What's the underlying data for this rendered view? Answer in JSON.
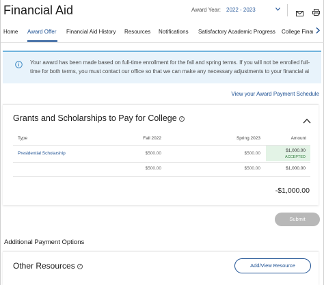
{
  "app": {
    "title": "Financial Aid"
  },
  "header": {
    "award_year_label": "Award Year:",
    "award_year_value": "2022 - 2023",
    "icons": [
      "chevron-down-icon",
      "mail-icon",
      "print-icon"
    ]
  },
  "tabs": [
    {
      "label": "Home",
      "active": false
    },
    {
      "label": "Award Offer",
      "active": true
    },
    {
      "label": "Financial Aid History",
      "active": false
    },
    {
      "label": "Resources",
      "active": false
    },
    {
      "label": "Notifications",
      "active": false
    },
    {
      "label": "Satisfactory Academic Progress",
      "active": false
    },
    {
      "label": "College Financ",
      "active": false
    }
  ],
  "notice": {
    "line1": "Your award has been made based on full-time enrollment for the fall and spring terms. If you will not be enrolled full-",
    "line2": "time for both terms, you must contact our office so that we can make any necessary adjustments to your financial ai"
  },
  "schedule_link": "View your Award Payment Schedule",
  "grants": {
    "title": "Grants and Scholarships to Pay for College",
    "columns": {
      "type": "Type",
      "fall": "Fall 2022",
      "spring": "Spring 2023",
      "amount": "Amount"
    },
    "rows": [
      {
        "name": "Presidential Scholarship",
        "fall": "$500.00",
        "spring": "$500.00",
        "amount": "$1,000.00",
        "status": "ACCEPTED"
      }
    ],
    "subtotal": {
      "fall": "$500.00",
      "spring": "$500.00",
      "amount": "$1,000.00"
    },
    "total": "-$1,000.00"
  },
  "actions": {
    "submit_label": "Submit"
  },
  "additional_heading": "Additional Payment Options",
  "other": {
    "title": "Other Resources",
    "button_label": "Add/View Resource"
  },
  "colors": {
    "accent": "#1b4f92",
    "info_bg": "#e8f3fb",
    "accepted_bg": "#e3f3e6",
    "disabled_button": "#b8b8b8"
  }
}
